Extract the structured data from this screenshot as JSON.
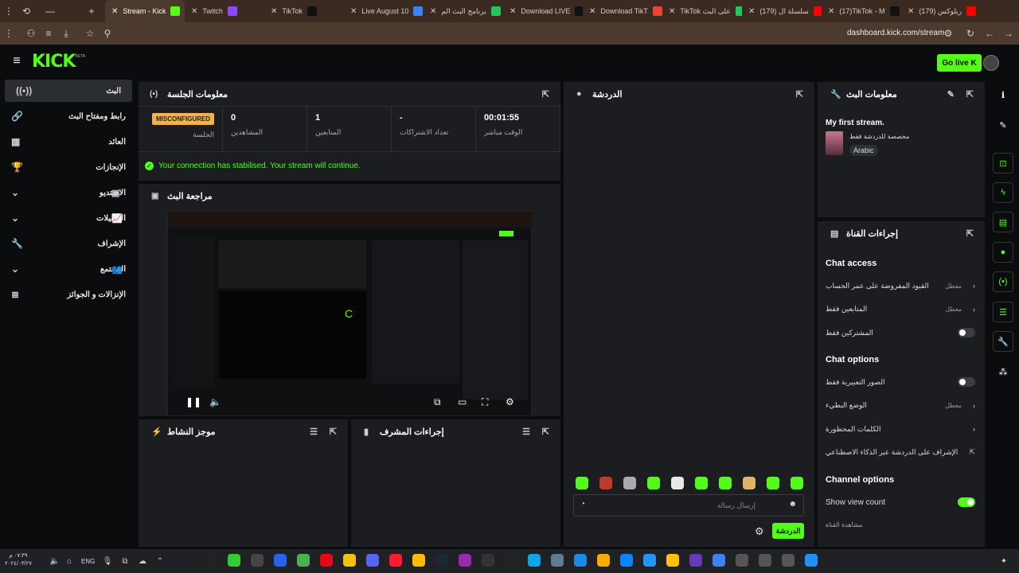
{
  "browser": {
    "tabs": [
      {
        "title": "Stream - Kick",
        "color": "#53fc18"
      },
      {
        "title": "Twitch",
        "color": "#9146ff"
      },
      {
        "title": "TikTok",
        "color": "#111111"
      },
      {
        "title": "Live August 10",
        "color": "#3b82f6"
      },
      {
        "title": "برنامج البث الم",
        "color": "#22c55e"
      },
      {
        "title": "Download LIVE",
        "color": "#111111"
      },
      {
        "title": "Download TikT",
        "color": "#ea4335"
      },
      {
        "title": "TikTok على البث",
        "color": "#22c55e"
      },
      {
        "title": "(179) سلسلة ال",
        "color": "#ff0000"
      },
      {
        "title": "(17)TikTok - M",
        "color": "#111111"
      },
      {
        "title": "(179) ريلوكس",
        "color": "#ff0000"
      }
    ],
    "url": "dashboard.kick.com/stream"
  },
  "topnav": {
    "logo": "KICK",
    "logo_sup": "BETA",
    "go_live": "Go live"
  },
  "sidebar": {
    "items": [
      {
        "label": "البث",
        "icon": "broadcast-icon",
        "glyph": "((•))",
        "active": true
      },
      {
        "label": "رابط ومفتاح البث",
        "icon": "link-icon",
        "glyph": "🔗"
      },
      {
        "label": "العائد",
        "icon": "chart-icon",
        "glyph": "▦"
      },
      {
        "label": "الإنجازات",
        "icon": "trophy-icon",
        "glyph": "🏆"
      },
      {
        "label": "الاستديو",
        "icon": "chevron-down-icon",
        "glyph": "⌄",
        "extra": "▣"
      },
      {
        "label": "التحليلات",
        "icon": "chevron-down-icon",
        "glyph": "⌄",
        "extra": "📈"
      },
      {
        "label": "الإشراف",
        "icon": "wrench-icon",
        "glyph": "🔧"
      },
      {
        "label": "المجتمع",
        "icon": "chevron-down-icon",
        "glyph": "⌄",
        "extra": "👥"
      },
      {
        "label": "الإنزالات و الجوائز",
        "icon": "gift-icon",
        "glyph": "≣"
      }
    ]
  },
  "session": {
    "title": "معلومات الجلسة",
    "stats": [
      {
        "value": "00:01:55",
        "label": "الوقت مباشر"
      },
      {
        "value": "-",
        "label": "تعداد الاشتراكات"
      },
      {
        "value": "1",
        "label": "المتابعين"
      },
      {
        "value": "0",
        "label": "المشاهدين"
      },
      {
        "value": "MISCONFIGURED",
        "label": "الجلسة"
      }
    ],
    "notice": "Your connection has stabilised. Your stream will continue."
  },
  "preview": {
    "title": "مراجعة البث"
  },
  "activity": {
    "title": "موجز النشاط"
  },
  "modactions": {
    "title": "إجراءات المشرف"
  },
  "chat": {
    "title": "الدردشة",
    "placeholder": "إرسال رسالة",
    "send": "الدردشة"
  },
  "streaminfo": {
    "title": "معلومات البث",
    "stream_title": "My first stream.",
    "category": "مخصصة للدردشة فقط",
    "language": "Arabic"
  },
  "channel_actions": {
    "title": "إجراءات القناة",
    "chat_access": "Chat access",
    "rows_access": [
      {
        "label": "القيود المفروضة على عمر الحساب",
        "state": "معطل",
        "type": "arrow"
      },
      {
        "label": "المتابعين فقط",
        "state": "معطل",
        "type": "arrow"
      },
      {
        "label": "المشتركين فقط",
        "state": "",
        "type": "toggle"
      }
    ],
    "chat_options": "Chat options",
    "rows_options": [
      {
        "label": "الصور التعبيرية فقط",
        "state": "",
        "type": "toggle"
      },
      {
        "label": "الوضع البطيء",
        "state": "معطل",
        "type": "arrow"
      },
      {
        "label": "الكلمات المحظورة",
        "state": "",
        "type": "arrow"
      },
      {
        "label": "الإشراف على الدردشة عبر الذكاء الاصطناعي",
        "state": "",
        "type": "external"
      }
    ],
    "channel_options": "Channel options",
    "show_view_count": "Show view count",
    "share_channel": "مشاهدة القناة"
  },
  "taskbar": {
    "lang": "ENG",
    "time": "٠٧:٣٩ م",
    "date": "٢٠٢٤/٠٣/٢٧"
  }
}
